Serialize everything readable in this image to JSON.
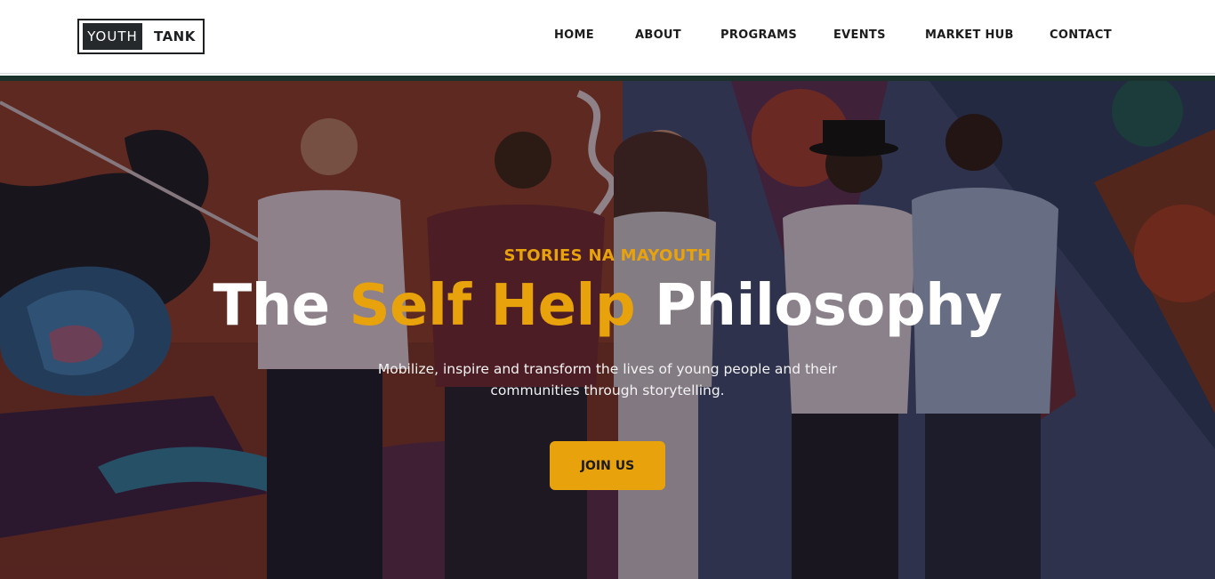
{
  "header": {
    "logo": {
      "part1": "YOUTH",
      "part2": "TANK"
    },
    "nav": [
      {
        "label": "HOME"
      },
      {
        "label": "ABOUT"
      },
      {
        "label": "PROGRAMS"
      },
      {
        "label": "EVENTS"
      },
      {
        "label": "MARKET HUB"
      },
      {
        "label": "CONTACT"
      }
    ]
  },
  "hero": {
    "eyebrow": "STORIES NA MAYOUTH",
    "headline": {
      "part1": "The",
      "highlight": "Self Help",
      "part2": "Philosophy"
    },
    "subtitle": "Mobilize, inspire and transform the lives of young people and their communities through storytelling.",
    "cta_label": "JOIN US"
  },
  "colors": {
    "accent": "#e8a20c",
    "nav_text": "#1c1c1c",
    "logo_dark": "#25292c",
    "headline_text": "#ffffff"
  }
}
